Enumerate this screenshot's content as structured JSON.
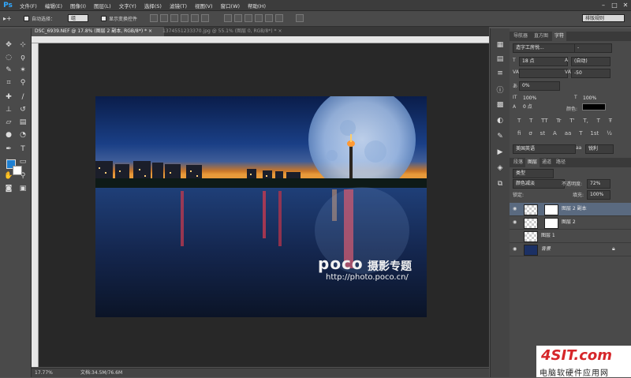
{
  "app": {
    "logo": "Ps"
  },
  "menu": {
    "items": [
      "文件(F)",
      "编辑(E)",
      "图像(I)",
      "图层(L)",
      "文字(Y)",
      "选择(S)",
      "滤镜(T)",
      "视图(V)",
      "窗口(W)",
      "帮助(H)"
    ]
  },
  "options": {
    "auto_select_label": "自动选择：",
    "auto_select_value": "组",
    "show_transform_label": "显示变换控件",
    "workspace": "排版规则"
  },
  "tabs": [
    {
      "label": "DSC_6939.NEF @ 17.8% (图层 2 副本, RGB/8*) *",
      "close": "×",
      "active": true
    },
    {
      "label": "1374551233370.jpg @ 55.1% (图层 0, RGB/8*) *",
      "close": "×",
      "active": false
    }
  ],
  "status": {
    "zoom": "17.77%",
    "doc": "文档:34.5M/76.6M"
  },
  "photo": {
    "watermark_brand": "poco",
    "watermark_cn": "摄影专题",
    "watermark_url": "http://photo.poco.cn/"
  },
  "panels": {
    "top_tabs": [
      "导航器",
      "直方图",
      "字符"
    ],
    "character": {
      "font_family": "造字工房悦...",
      "font_style": "-",
      "size": "18 点",
      "leading": "(自动)",
      "kerning_value": "-50",
      "tracking": "0%",
      "scale_v": "100%",
      "scale_h": "100%",
      "baseline": "0 点",
      "color_label": "颜色:",
      "style_buttons": [
        "T",
        "T",
        "TT",
        "Tr",
        "T'",
        "T,",
        "T",
        "Ŧ"
      ],
      "opentype_buttons": [
        "fi",
        "σ",
        "st",
        "A",
        "aa",
        "T",
        "1st",
        "½"
      ],
      "language": "美国英语",
      "aa_label": "aa",
      "antialias": "锐利"
    },
    "layers_tabs": [
      "段落",
      "图层",
      "通道",
      "路径"
    ],
    "layers": {
      "filter_kind": "类型",
      "blend_mode": "颜色减淡",
      "opacity_label": "不透明度:",
      "opacity": "72%",
      "lock_label": "锁定:",
      "fill_label": "填充:",
      "fill": "100%",
      "items": [
        {
          "name": "图层 2 副本",
          "visible": true,
          "selected": true
        },
        {
          "name": "图层 2",
          "visible": true,
          "selected": false
        },
        {
          "name": "图层 1",
          "visible": false,
          "selected": false
        },
        {
          "name": "背景",
          "visible": true,
          "selected": false
        }
      ]
    }
  },
  "site_watermark": {
    "logo": "4SIT.com",
    "tagline": "电脑软硬件应用网"
  },
  "colors": {
    "accent": "#31a8ff",
    "foreground": "#1e7fd1",
    "background": "#ffffff",
    "selected_layer": "#5a6a80"
  }
}
